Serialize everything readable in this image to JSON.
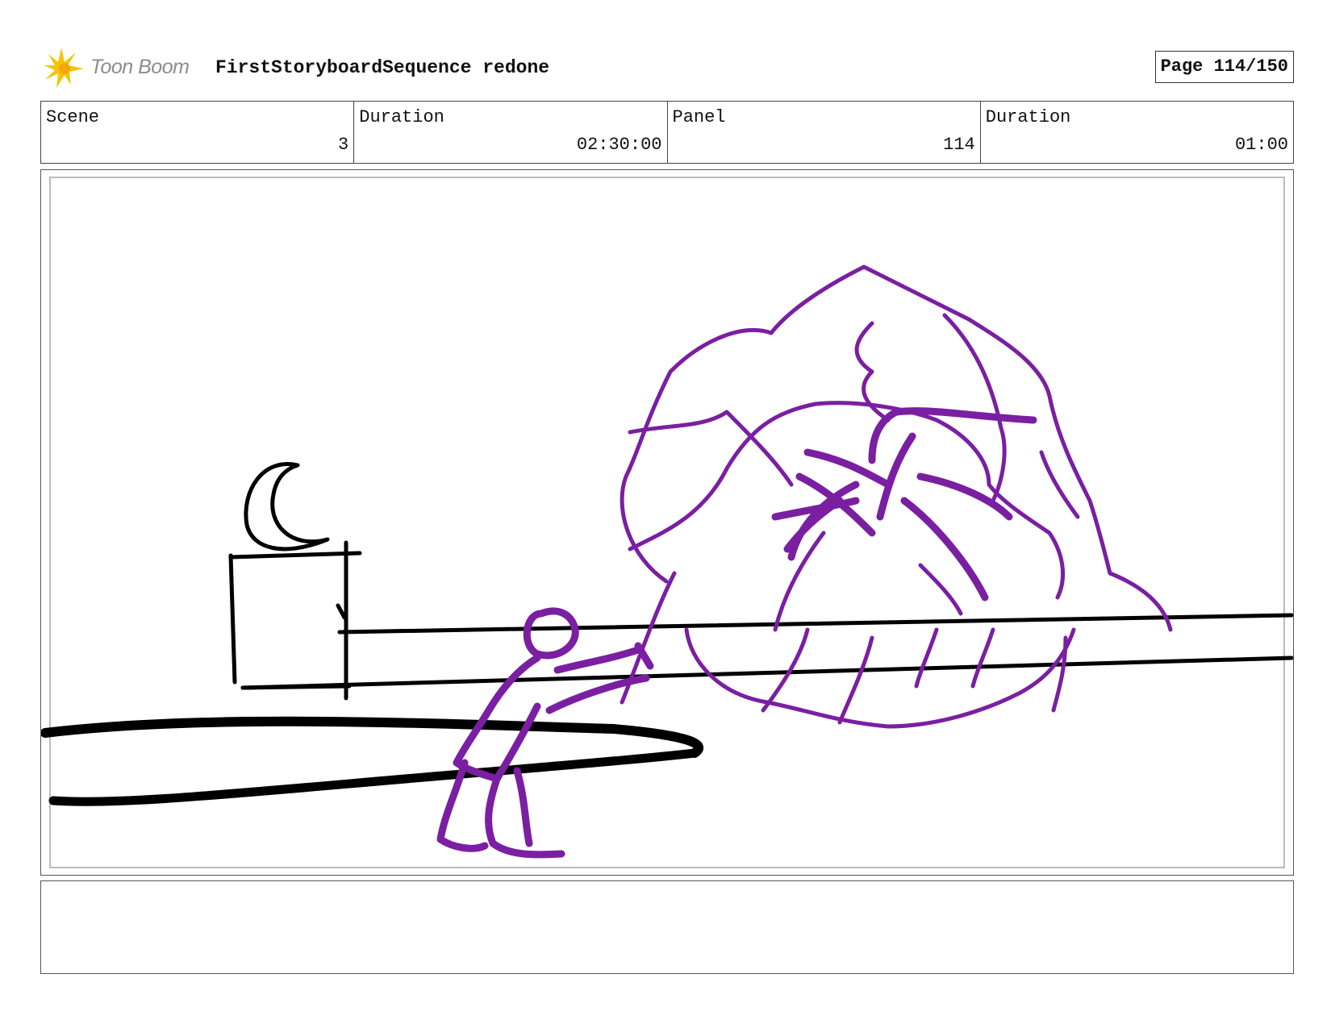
{
  "header": {
    "logo_text": "Toon Boom",
    "project_title": "FirstStoryboardSequence redone",
    "page_label": "Page 114/150"
  },
  "info": {
    "scene_label": "Scene",
    "scene_value": "3",
    "scene_duration_label": "Duration",
    "scene_duration_value": "02:30:00",
    "panel_label": "Panel",
    "panel_value": "114",
    "panel_duration_label": "Duration",
    "panel_duration_value": "01:00"
  },
  "drawing": {
    "sketch_color": "#7a1fa2",
    "ink_color": "#000000"
  },
  "notes": {
    "text": ""
  }
}
